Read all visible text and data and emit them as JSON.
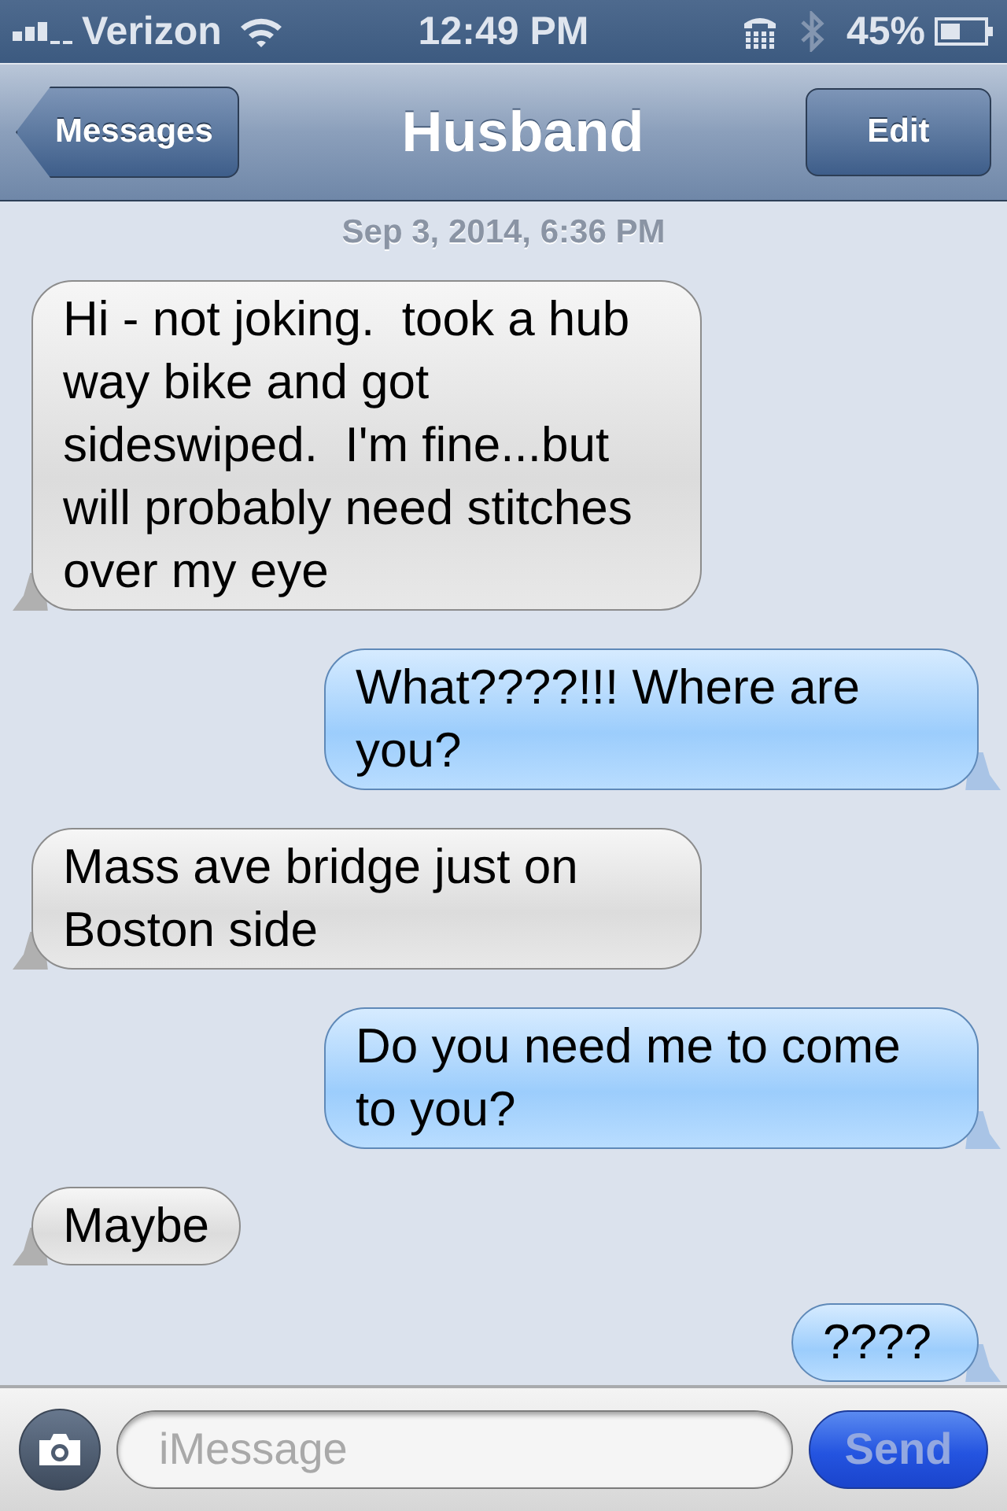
{
  "status_bar": {
    "carrier": "Verizon",
    "time": "12:49 PM",
    "battery": "45%"
  },
  "nav_bar": {
    "back": "Messages",
    "title": "Husband",
    "action": "Edit"
  },
  "conversation": {
    "timestamp": "Sep 3, 2014, 6:36 PM",
    "messages": [
      {
        "kind": "received",
        "text": "Hi - not joking.  took a hub way bike and got sideswiped.  I'm fine...but will probably need stitches over my eye"
      },
      {
        "kind": "sent",
        "text": "What????!!! Where are you?"
      },
      {
        "kind": "received",
        "text": "Mass ave bridge just on Boston side"
      },
      {
        "kind": "sent",
        "text": "Do you need me to come to you?"
      },
      {
        "kind": "received",
        "text": "Maybe"
      },
      {
        "kind": "sent",
        "text": "????"
      }
    ]
  },
  "compose": {
    "placeholder": "iMessage",
    "send": "Send",
    "send_disabled": true
  }
}
